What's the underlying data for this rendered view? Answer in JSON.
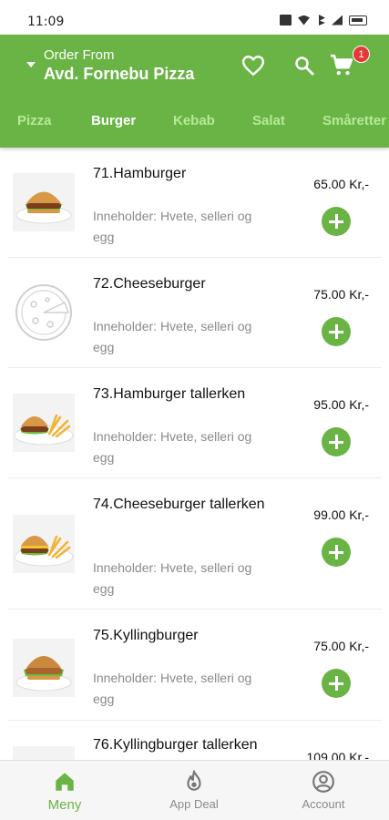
{
  "status_bar": {
    "time": "11:09"
  },
  "header": {
    "order_from_label": "Order From",
    "store_name": "Avd. Fornebu Pizza",
    "cart_count": "1",
    "accent_color": "#6ab446",
    "badge_color": "#e53935"
  },
  "tabs": [
    {
      "label": "Pizza",
      "active": false
    },
    {
      "label": "Burger",
      "active": true
    },
    {
      "label": "Kebab",
      "active": false
    },
    {
      "label": "Salat",
      "active": false
    },
    {
      "label": "Småretter",
      "active": false
    }
  ],
  "menu_items": [
    {
      "name": "71.Hamburger",
      "description": "Inneholder: Hvete, selleri og egg",
      "price": "65.00 Kr,-",
      "image": "burger"
    },
    {
      "name": "72.Cheeseburger",
      "description": "Inneholder: Hvete, selleri og egg",
      "price": "75.00 Kr,-",
      "image": "pizza-placeholder"
    },
    {
      "name": "73.Hamburger tallerken",
      "description": "Inneholder: Hvete, selleri og egg",
      "price": "95.00 Kr,-",
      "image": "burger-fries"
    },
    {
      "name": "74.Cheeseburger tallerken",
      "description": "Inneholder: Hvete, selleri og egg",
      "price": "99.00 Kr,-",
      "image": "burger-fries"
    },
    {
      "name": "75.Kyllingburger",
      "description": "Inneholder: Hvete, selleri og egg",
      "price": "75.00 Kr,-",
      "image": "burger"
    },
    {
      "name": "76.Kyllingburger tallerken",
      "description": "",
      "price": "109.00 Kr,-",
      "image": "burger-fries"
    }
  ],
  "bottom_nav": [
    {
      "label": "Meny",
      "icon": "home-icon",
      "active": true
    },
    {
      "label": "App Deal",
      "icon": "deal-icon",
      "active": false
    },
    {
      "label": "Account",
      "icon": "account-icon",
      "active": false
    }
  ]
}
